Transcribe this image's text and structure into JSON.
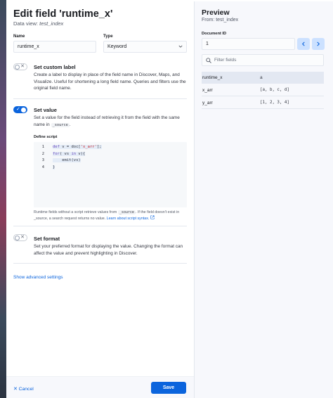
{
  "editor": {
    "title": "Edit field 'runtime_x'",
    "data_view_label": "Data view:",
    "data_view_name": "test_index",
    "name_label": "Name",
    "name_value": "runtime_x",
    "type_label": "Type",
    "type_value": "Keyword",
    "custom_label": {
      "title": "Set custom label",
      "description": "Create a label to display in place of the field name in Discover, Maps, and Visualize. Useful for shortening a long field name. Queries and filters use the original field name.",
      "enabled": false
    },
    "set_value": {
      "title": "Set value",
      "description_pre": "Set a value for the field instead of retrieving it from the field with the same name in",
      "description_code": "_source",
      "description_post": ".",
      "enabled": true,
      "script_label": "Define script",
      "line_numbers": [
        "1",
        "2",
        "3",
        "4"
      ],
      "help_pre": "Runtime fields without a script retrieve values from",
      "help_code": "_source",
      "help_mid": ". If the field doesn't exist in _source, a search request returns no value.",
      "help_link": "Learn about script syntax."
    },
    "set_format": {
      "title": "Set format",
      "description": "Set your preferred format for displaying the value. Changing the format can affect the value and prevent highlighting in Discover.",
      "enabled": false
    },
    "advanced_link": "Show advanced settings",
    "cancel_label": "Cancel",
    "save_label": "Save"
  },
  "preview": {
    "title": "Preview",
    "subtitle": "From: test_index",
    "document_id_label": "Document ID",
    "document_id_value": "1",
    "filter_placeholder": "Filter fields",
    "rows": [
      {
        "field": "runtime_x",
        "value": "a"
      },
      {
        "field": "x_arr",
        "value": "[a, b, c, d]"
      },
      {
        "field": "y_arr",
        "value": "[1, 2, 3, 4]"
      }
    ]
  },
  "colors": {
    "accent": "#0b64dd",
    "preview_bg": "#f7f8fc",
    "highlight_row": "#e3e8f2"
  },
  "icons": {
    "cancel": "cross-icon",
    "prev": "chevron-left-icon",
    "next": "chevron-right-icon",
    "filter": "search-icon",
    "select": "chevron-down-icon",
    "external": "external-link-icon"
  }
}
